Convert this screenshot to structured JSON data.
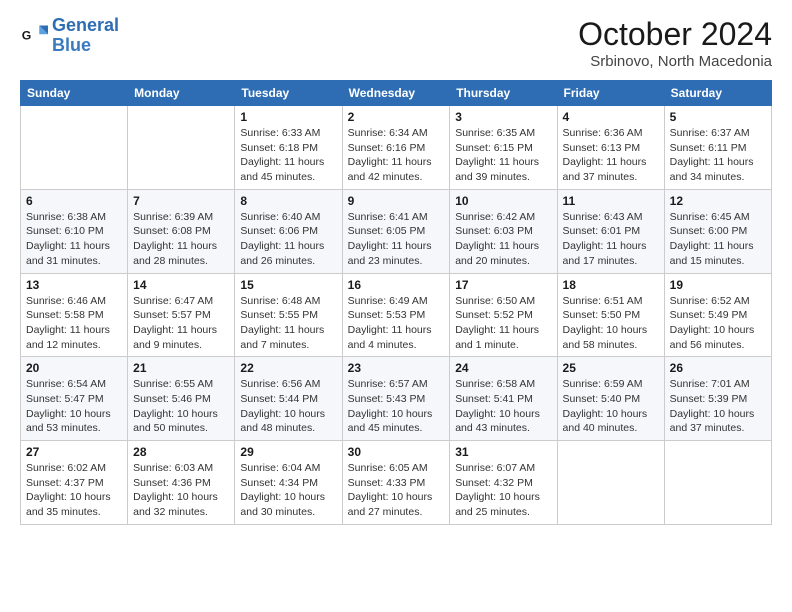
{
  "logo": {
    "line1": "General",
    "line2": "Blue"
  },
  "title": "October 2024",
  "location": "Srbinovo, North Macedonia",
  "weekdays": [
    "Sunday",
    "Monday",
    "Tuesday",
    "Wednesday",
    "Thursday",
    "Friday",
    "Saturday"
  ],
  "weeks": [
    [
      {
        "day": "",
        "info": ""
      },
      {
        "day": "",
        "info": ""
      },
      {
        "day": "1",
        "info": "Sunrise: 6:33 AM\nSunset: 6:18 PM\nDaylight: 11 hours and 45 minutes."
      },
      {
        "day": "2",
        "info": "Sunrise: 6:34 AM\nSunset: 6:16 PM\nDaylight: 11 hours and 42 minutes."
      },
      {
        "day": "3",
        "info": "Sunrise: 6:35 AM\nSunset: 6:15 PM\nDaylight: 11 hours and 39 minutes."
      },
      {
        "day": "4",
        "info": "Sunrise: 6:36 AM\nSunset: 6:13 PM\nDaylight: 11 hours and 37 minutes."
      },
      {
        "day": "5",
        "info": "Sunrise: 6:37 AM\nSunset: 6:11 PM\nDaylight: 11 hours and 34 minutes."
      }
    ],
    [
      {
        "day": "6",
        "info": "Sunrise: 6:38 AM\nSunset: 6:10 PM\nDaylight: 11 hours and 31 minutes."
      },
      {
        "day": "7",
        "info": "Sunrise: 6:39 AM\nSunset: 6:08 PM\nDaylight: 11 hours and 28 minutes."
      },
      {
        "day": "8",
        "info": "Sunrise: 6:40 AM\nSunset: 6:06 PM\nDaylight: 11 hours and 26 minutes."
      },
      {
        "day": "9",
        "info": "Sunrise: 6:41 AM\nSunset: 6:05 PM\nDaylight: 11 hours and 23 minutes."
      },
      {
        "day": "10",
        "info": "Sunrise: 6:42 AM\nSunset: 6:03 PM\nDaylight: 11 hours and 20 minutes."
      },
      {
        "day": "11",
        "info": "Sunrise: 6:43 AM\nSunset: 6:01 PM\nDaylight: 11 hours and 17 minutes."
      },
      {
        "day": "12",
        "info": "Sunrise: 6:45 AM\nSunset: 6:00 PM\nDaylight: 11 hours and 15 minutes."
      }
    ],
    [
      {
        "day": "13",
        "info": "Sunrise: 6:46 AM\nSunset: 5:58 PM\nDaylight: 11 hours and 12 minutes."
      },
      {
        "day": "14",
        "info": "Sunrise: 6:47 AM\nSunset: 5:57 PM\nDaylight: 11 hours and 9 minutes."
      },
      {
        "day": "15",
        "info": "Sunrise: 6:48 AM\nSunset: 5:55 PM\nDaylight: 11 hours and 7 minutes."
      },
      {
        "day": "16",
        "info": "Sunrise: 6:49 AM\nSunset: 5:53 PM\nDaylight: 11 hours and 4 minutes."
      },
      {
        "day": "17",
        "info": "Sunrise: 6:50 AM\nSunset: 5:52 PM\nDaylight: 11 hours and 1 minute."
      },
      {
        "day": "18",
        "info": "Sunrise: 6:51 AM\nSunset: 5:50 PM\nDaylight: 10 hours and 58 minutes."
      },
      {
        "day": "19",
        "info": "Sunrise: 6:52 AM\nSunset: 5:49 PM\nDaylight: 10 hours and 56 minutes."
      }
    ],
    [
      {
        "day": "20",
        "info": "Sunrise: 6:54 AM\nSunset: 5:47 PM\nDaylight: 10 hours and 53 minutes."
      },
      {
        "day": "21",
        "info": "Sunrise: 6:55 AM\nSunset: 5:46 PM\nDaylight: 10 hours and 50 minutes."
      },
      {
        "day": "22",
        "info": "Sunrise: 6:56 AM\nSunset: 5:44 PM\nDaylight: 10 hours and 48 minutes."
      },
      {
        "day": "23",
        "info": "Sunrise: 6:57 AM\nSunset: 5:43 PM\nDaylight: 10 hours and 45 minutes."
      },
      {
        "day": "24",
        "info": "Sunrise: 6:58 AM\nSunset: 5:41 PM\nDaylight: 10 hours and 43 minutes."
      },
      {
        "day": "25",
        "info": "Sunrise: 6:59 AM\nSunset: 5:40 PM\nDaylight: 10 hours and 40 minutes."
      },
      {
        "day": "26",
        "info": "Sunrise: 7:01 AM\nSunset: 5:39 PM\nDaylight: 10 hours and 37 minutes."
      }
    ],
    [
      {
        "day": "27",
        "info": "Sunrise: 6:02 AM\nSunset: 4:37 PM\nDaylight: 10 hours and 35 minutes."
      },
      {
        "day": "28",
        "info": "Sunrise: 6:03 AM\nSunset: 4:36 PM\nDaylight: 10 hours and 32 minutes."
      },
      {
        "day": "29",
        "info": "Sunrise: 6:04 AM\nSunset: 4:34 PM\nDaylight: 10 hours and 30 minutes."
      },
      {
        "day": "30",
        "info": "Sunrise: 6:05 AM\nSunset: 4:33 PM\nDaylight: 10 hours and 27 minutes."
      },
      {
        "day": "31",
        "info": "Sunrise: 6:07 AM\nSunset: 4:32 PM\nDaylight: 10 hours and 25 minutes."
      },
      {
        "day": "",
        "info": ""
      },
      {
        "day": "",
        "info": ""
      }
    ]
  ]
}
